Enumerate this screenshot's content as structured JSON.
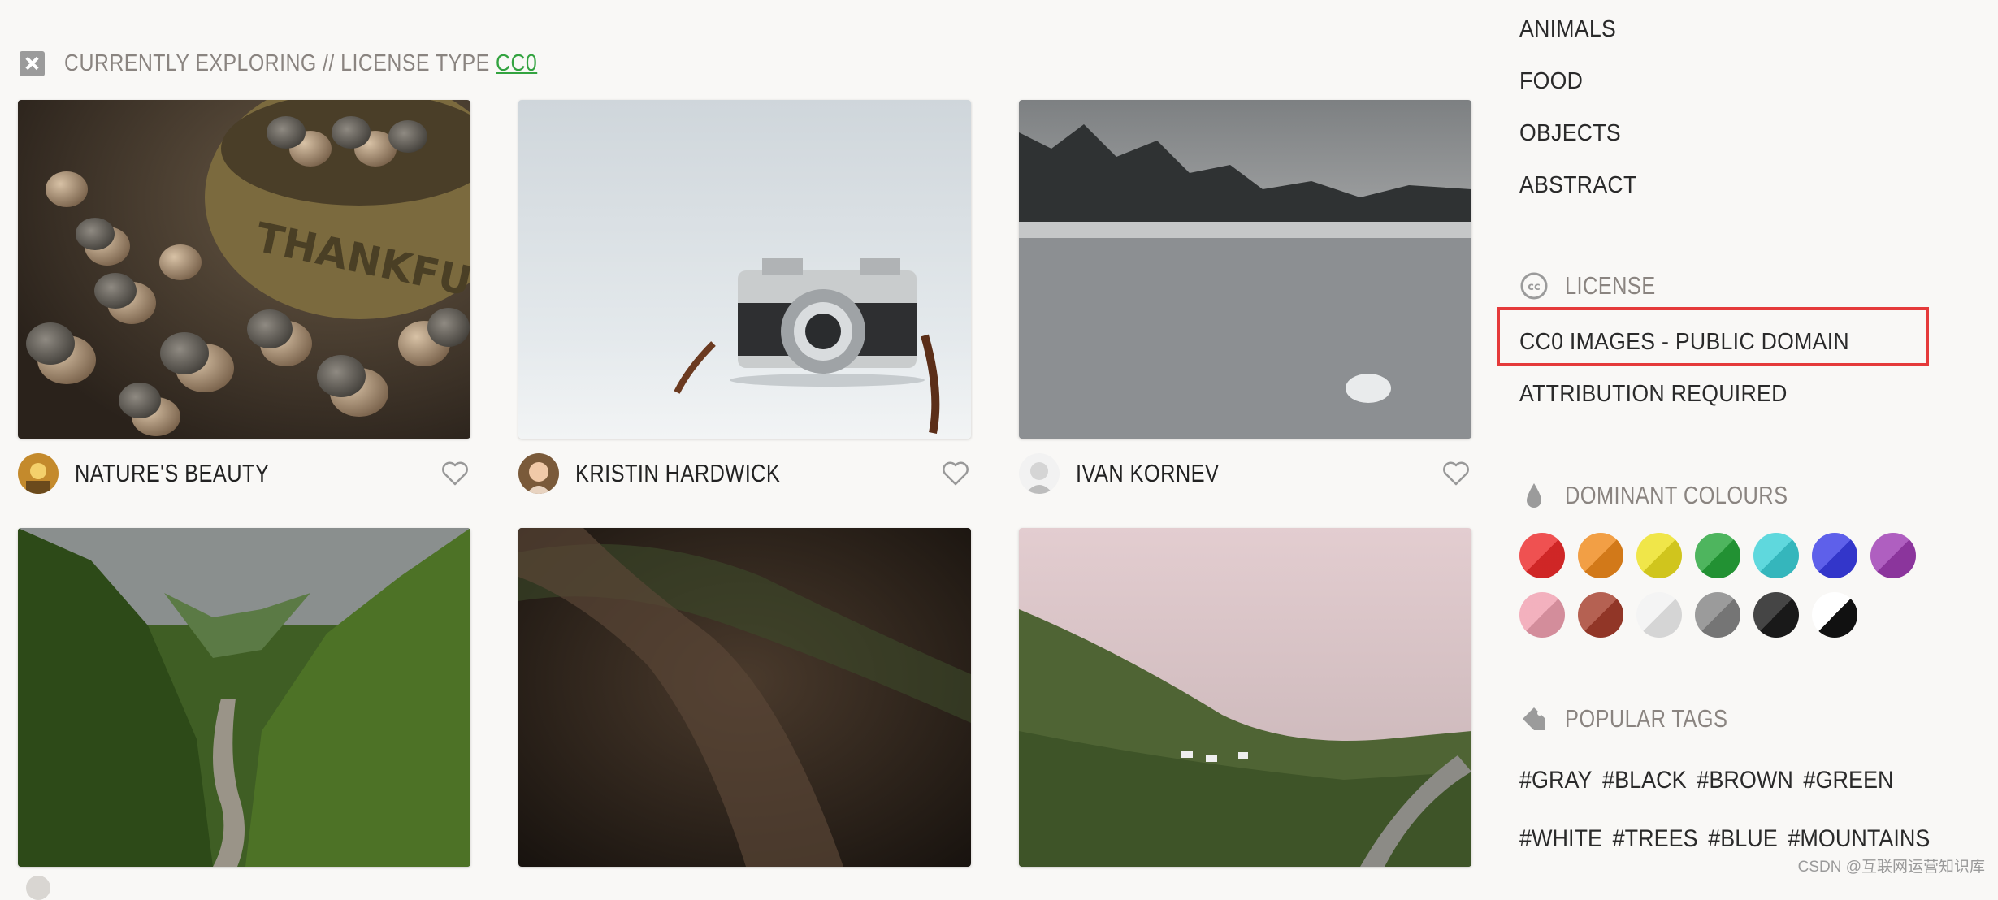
{
  "explore": {
    "prefix": "CURRENTLY EXPLORING // LICENSE TYPE ",
    "license": "CC0"
  },
  "photos": [
    {
      "author": "NATURE'S BEAUTY",
      "image": "acorns-in-thankful-bowl"
    },
    {
      "author": "KRISTIN HARDWICK",
      "image": "vintage-camera"
    },
    {
      "author": "IVAN KORNEV",
      "image": "frozen-lake"
    },
    {
      "image": "green-valley-river"
    },
    {
      "image": "leaf-covered-path"
    },
    {
      "image": "misty-valley-road"
    }
  ],
  "sidebar": {
    "categories": [
      "ANIMALS",
      "FOOD",
      "OBJECTS",
      "ABSTRACT"
    ],
    "license": {
      "heading": "LICENSE",
      "options": [
        "CC0 IMAGES - PUBLIC DOMAIN",
        "ATTRIBUTION REQUIRED"
      ],
      "highlighted": "CC0 IMAGES - PUBLIC DOMAIN"
    },
    "colours": {
      "heading": "DOMINANT COLOURS",
      "swatches": [
        "#ec2b2b",
        "#ef8a1c",
        "#ede021",
        "#27a53a",
        "#3ccfd6",
        "#3a3de6",
        "#9e3cb2",
        "#f0a0b0",
        "#a53e2c",
        "#f2f2f2",
        "#858585",
        "#1c1c1c",
        "black-and-white"
      ]
    },
    "tags": {
      "heading": "POPULAR TAGS",
      "row1": [
        "#GRAY",
        "#BLACK",
        "#BROWN",
        "#GREEN"
      ],
      "row2": [
        "#WHITE",
        "#TREES",
        "#BLUE",
        "#MOUNTAINS"
      ]
    }
  },
  "icons": {
    "close": "close-icon",
    "heart": "heart-icon",
    "license": "creative-commons-icon",
    "colours": "drop-icon",
    "tags": "tag-icon"
  },
  "watermark": "CSDN @互联网运营知识库"
}
